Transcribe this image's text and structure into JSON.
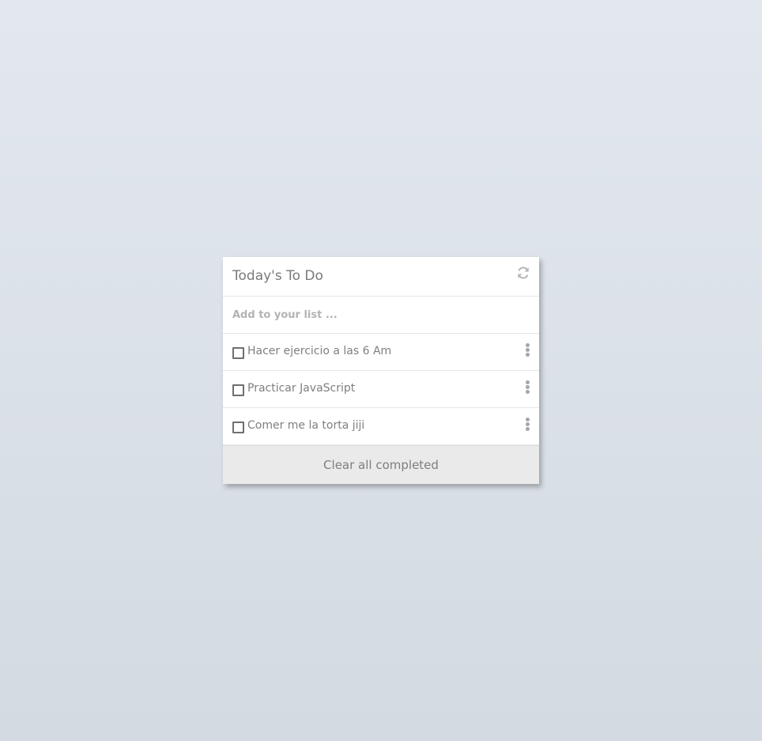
{
  "card": {
    "title": "Today's To Do",
    "refresh_icon": "refresh-icon",
    "input": {
      "placeholder": "Add to your list ...",
      "value": ""
    },
    "items": [
      {
        "label": "Hacer ejercicio a las 6 Am",
        "checked": false
      },
      {
        "label": "Practicar JavaScript",
        "checked": false
      },
      {
        "label": "Comer me la torta jiji",
        "checked": false
      }
    ],
    "clear_label": "Clear all completed"
  },
  "colors": {
    "background_top": "#e2e8ee",
    "background_bottom": "#d3dae1",
    "card": "#ffffff",
    "footer": "#eaeaea",
    "text": "#7f7f7f"
  }
}
